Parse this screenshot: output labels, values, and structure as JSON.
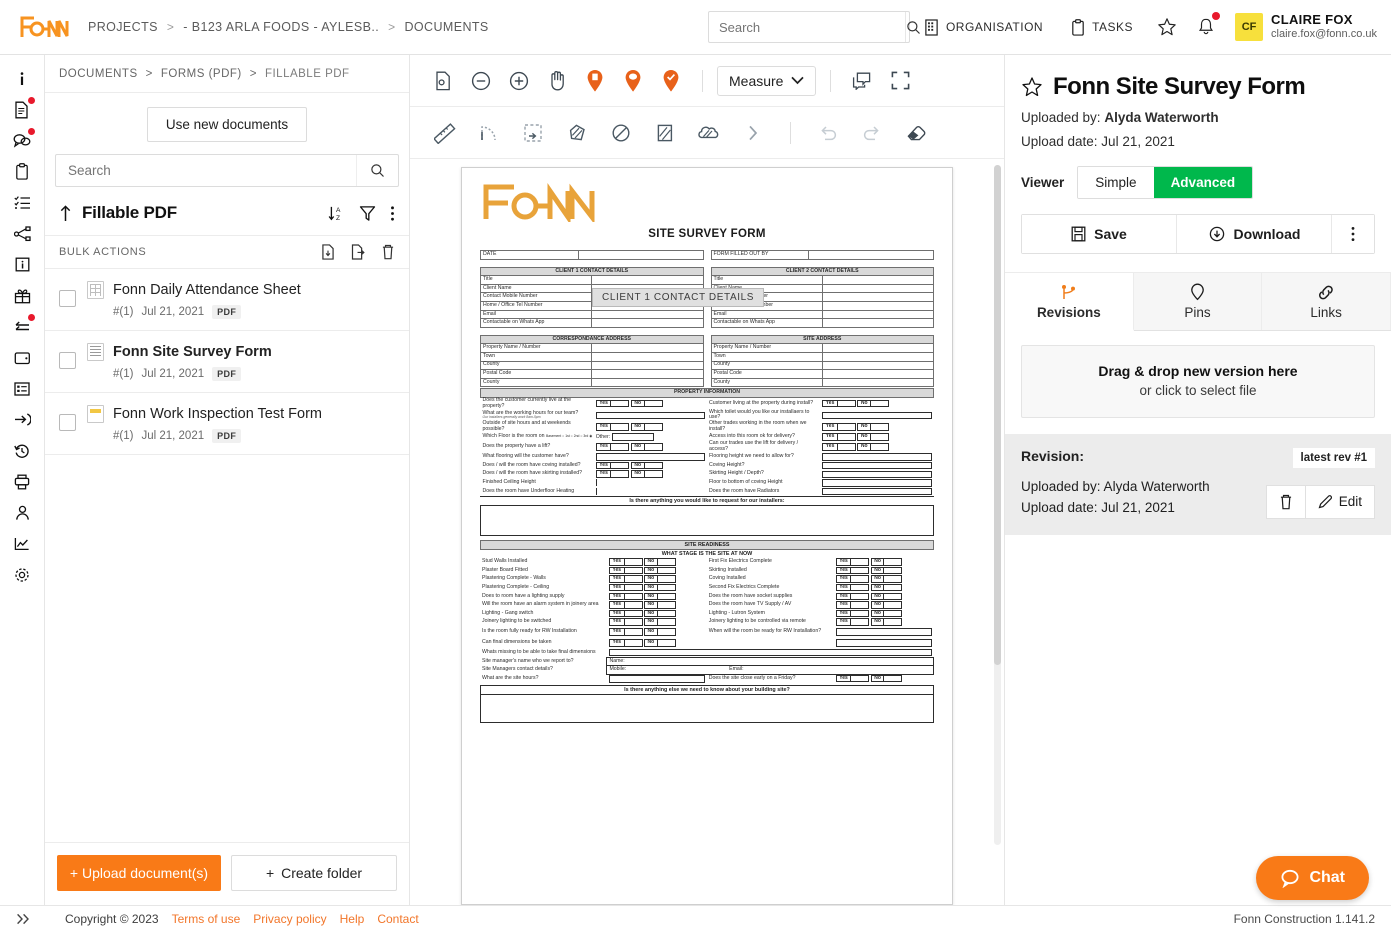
{
  "header": {
    "logo": "FONN",
    "breadcrumbs": [
      "PROJECTS",
      "- B123 ARLA FOODS - AYLESB..",
      "DOCUMENTS"
    ],
    "search_placeholder": "Search",
    "organisation_label": "ORGANISATION",
    "tasks_label": "TASKS",
    "user": {
      "initials": "CF",
      "name": "CLAIRE FOX",
      "email": "claire.fox@fonn.co.uk"
    }
  },
  "list_panel": {
    "breadcrumbs": [
      "DOCUMENTS",
      "FORMS (PDF)",
      "FILLABLE PDF"
    ],
    "new_docs_button": "Use new documents",
    "search_placeholder": "Search",
    "title": "Fillable PDF",
    "bulk_label": "BULK ACTIONS",
    "documents": [
      {
        "name": "Fonn Daily Attendance Sheet",
        "ref": "#(1)",
        "date": "Jul 21, 2021",
        "type": "PDF",
        "selected": false
      },
      {
        "name": "Fonn Site Survey Form",
        "ref": "#(1)",
        "date": "Jul 21, 2021",
        "type": "PDF",
        "selected": true
      },
      {
        "name": "Fonn Work Inspection Test Form",
        "ref": "#(1)",
        "date": "Jul 21, 2021",
        "type": "PDF",
        "selected": false
      }
    ],
    "upload_button": "+ Upload document(s)",
    "create_folder_button": "Create folder"
  },
  "viewer_toolbar": {
    "measure_label": "Measure"
  },
  "document": {
    "logo": "FONN",
    "title": "SITE SURVEY FORM",
    "tooltip": "CLIENT 1 CONTACT DETAILS",
    "date_label": "DATE",
    "filled_by_label": "FORM FILLED OUT BY",
    "client1_header": "CLIENT 1 CONTACT DETAILS",
    "client2_header": "CLIENT 2 CONTACT DETAILS",
    "contact_rows": [
      "Title",
      "Client Name",
      "Contact Mobile Number",
      "Home / Office Tel Number",
      "Email",
      "Contactable on Whats App"
    ],
    "correspondance_header": "CORRESPONDANCE ADDRESS",
    "site_address_header": "SITE ADDRESS",
    "address_rows": [
      "Property Name / Number",
      "Town",
      "County",
      "Postal Code",
      "County"
    ],
    "property_info_header": "PROPERTY INFORMATION",
    "property_left": [
      {
        "label": "Does the customer currently live at the property?",
        "kind": "yesno"
      },
      {
        "label": "What are the working hours for our team?",
        "sub": "Our installers generally work 8am-5pm",
        "kind": "field"
      },
      {
        "label": "Outside of site hours and at weekends possible?",
        "kind": "yesno"
      },
      {
        "label": "Which Floor is the room on",
        "kind": "floor",
        "options": [
          "Basement",
          "1st",
          "2nd",
          "3rd"
        ],
        "other_label": "Other:"
      },
      {
        "label": "Does the property have a lift?",
        "kind": "yesno"
      },
      {
        "label": "What flooring will the customer have?",
        "kind": "field"
      },
      {
        "label": "Does / will the room have coving installed?",
        "kind": "yesno"
      },
      {
        "label": "Does / will the room have skirting installed?",
        "kind": "yesno"
      },
      {
        "label": "Finished Ceiling Height",
        "kind": "field"
      },
      {
        "label": "Does the room have Underfloor Heating",
        "kind": "field"
      }
    ],
    "property_right": [
      {
        "label": "Customer living at the property during install?",
        "kind": "yesno"
      },
      {
        "label": "Which toilet would you like our installaers to use?",
        "kind": "field"
      },
      {
        "label": "Other trades working in the room when we install?",
        "kind": "yesno"
      },
      {
        "label": "Access into this room ok for delivery?",
        "kind": "yesno"
      },
      {
        "label": "Can our trades use the lift for delivery / access?",
        "kind": "yesno"
      },
      {
        "label": "Flooring height we need to allow for?",
        "kind": "field"
      },
      {
        "label": "Coving Height?",
        "kind": "field"
      },
      {
        "label": "Skirting Height / Depth?",
        "kind": "field"
      },
      {
        "label": "Floor to bottom of coving Height",
        "kind": "field"
      },
      {
        "label": "Does the room have Radiators",
        "kind": "field"
      }
    ],
    "request_header": "Is there anything you would like to request for our installers:",
    "site_readiness_header": "SITE READINESS",
    "stage_header": "WHAT STAGE IS THE SITE AT NOW",
    "stage_left": [
      {
        "label": "Stud Walls Installed",
        "kind": "yesno"
      },
      {
        "label": "Plaster Board Fitted",
        "kind": "yesno"
      },
      {
        "label": "Plastering Complete - Walls",
        "kind": "yesno"
      },
      {
        "label": "Plastering Complete - Ceiling",
        "kind": "yesno"
      },
      {
        "label": "Does to room have a lighting supply",
        "kind": "yesno"
      },
      {
        "label": "Will the room have an alarm system in joinery area",
        "kind": "yesno"
      },
      {
        "label": "Lighting - Gang switch",
        "kind": "yesno"
      },
      {
        "label": "Joinery lighting to be switched",
        "kind": "yesno"
      },
      {
        "label": "Is the room fully ready for RW Installation",
        "kind": "yesno"
      },
      {
        "label": "Can final dimensions be taken",
        "kind": "yesno"
      },
      {
        "label": "Whats missing to be able to take final dimensions",
        "kind": "wide"
      },
      {
        "label": "Site manager's name who we report to?",
        "kind": "name"
      },
      {
        "label": "Site Managers contact details?",
        "kind": "contact"
      },
      {
        "label": "What are the site hours?",
        "kind": "field"
      }
    ],
    "stage_right": [
      {
        "label": "First Fix Electrics Complete",
        "kind": "yesno"
      },
      {
        "label": "Skirting Installed",
        "kind": "yesno"
      },
      {
        "label": "Coving Installed",
        "kind": "yesno"
      },
      {
        "label": "Second Fix Electrics Complete",
        "kind": "yesno"
      },
      {
        "label": "Does the room have socket supplies",
        "kind": "yesno"
      },
      {
        "label": "Does the room have TV Supply / AV",
        "kind": "yesno"
      },
      {
        "label": "Lighting - Lutron System",
        "kind": "yesno"
      },
      {
        "label": "Joinery lighting to be controlled via remote",
        "kind": "yesno"
      },
      {
        "label": "When will the room be ready for RW Installation?",
        "kind": "field"
      },
      {
        "label": "",
        "kind": "field"
      },
      {
        "label": "",
        "kind": "none"
      },
      {
        "label": "",
        "kind": "none"
      },
      {
        "label": "",
        "kind": "none"
      },
      {
        "label": "Does the site close early on a Friday?",
        "kind": "yesno"
      }
    ],
    "name_label": "Name:",
    "mobile_label": "Mobile:",
    "email_label": "Email:",
    "yes_label": "Yes",
    "no_label": "No",
    "final_header": "Is there anything else we need to know about your building site?"
  },
  "right_panel": {
    "title": "Fonn Site Survey Form",
    "uploaded_by_label": "Uploaded by:",
    "uploaded_by": "Alyda Waterworth",
    "upload_date_line": "Upload date: Jul 21, 2021",
    "viewer_label": "Viewer",
    "viewer_simple": "Simple",
    "viewer_advanced": "Advanced",
    "save_label": "Save",
    "download_label": "Download",
    "tabs": [
      {
        "label": "Revisions",
        "active": true
      },
      {
        "label": "Pins",
        "active": false
      },
      {
        "label": "Links",
        "active": false
      }
    ],
    "dropzone_title": "Drag & drop new version here",
    "dropzone_sub": "or click to select file",
    "revision_label": "Revision:",
    "revision_badge": "latest rev #1",
    "revision_uploaded_by": "Uploaded by: Alyda Waterworth",
    "revision_date": "Upload date: Jul 21, 2021",
    "edit_label": "Edit"
  },
  "footer": {
    "copyright": "Copyright © 2023",
    "links": [
      "Terms of use",
      "Privacy policy",
      "Help",
      "Contact"
    ],
    "version": "Fonn Construction 1.141.2"
  },
  "chat": {
    "label": "Chat"
  },
  "colors": {
    "accent_orange": "#f97a17",
    "green": "#00b84c",
    "yellow": "#f7e03c",
    "red": "#e8192c"
  }
}
